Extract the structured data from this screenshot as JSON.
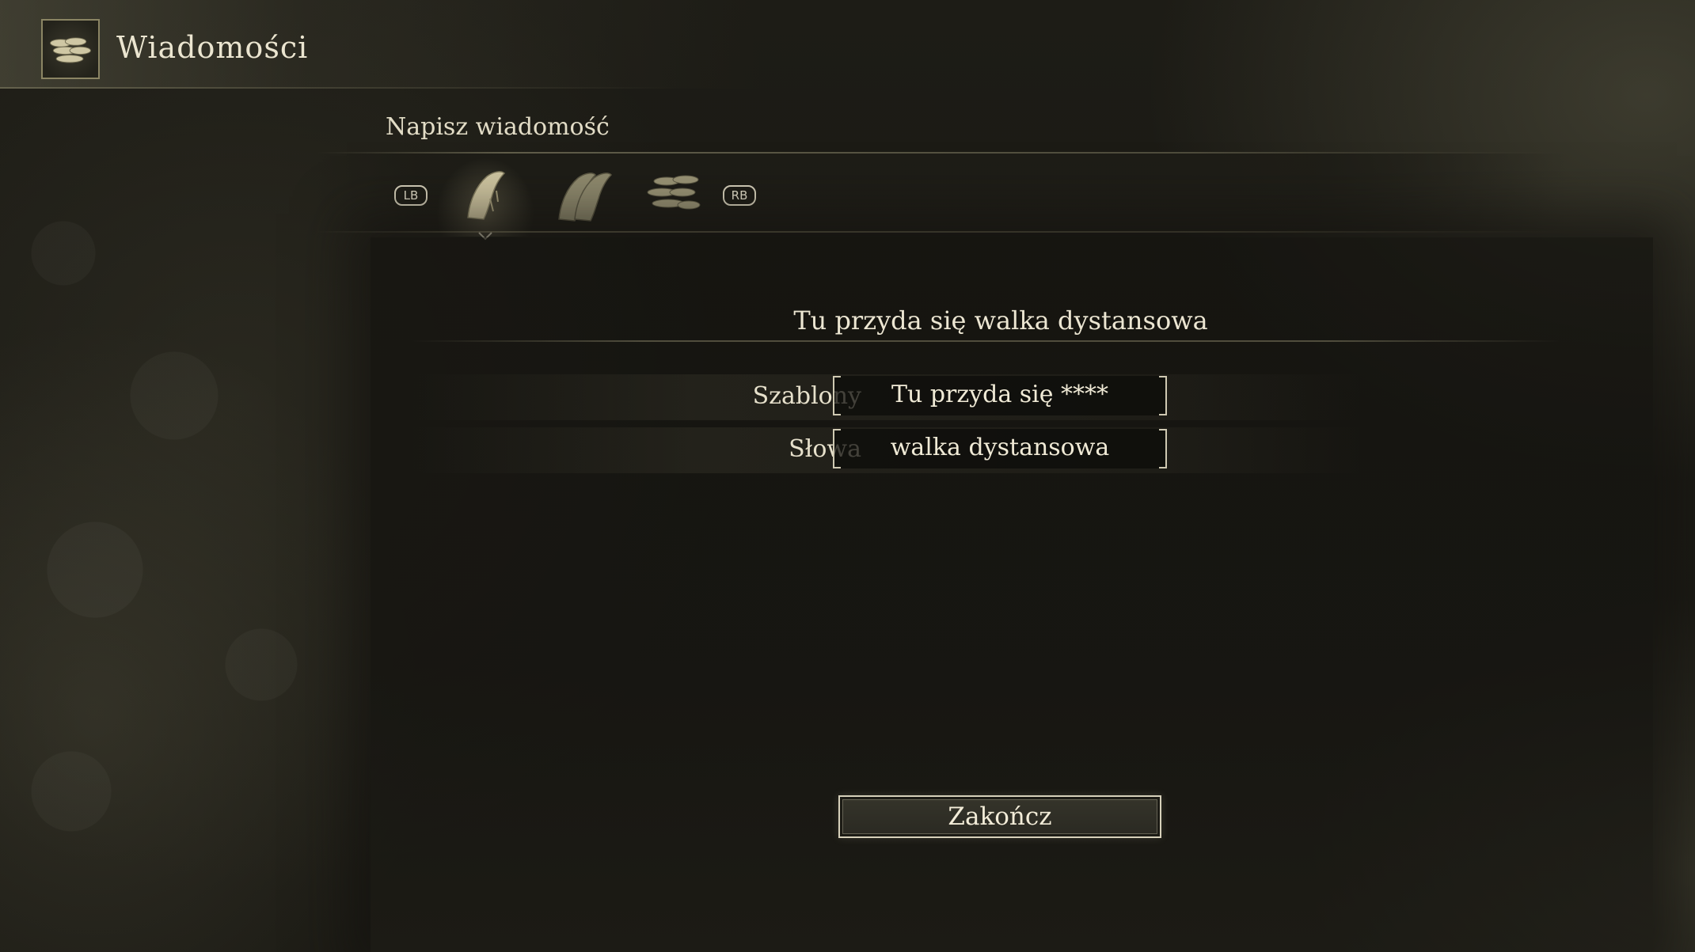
{
  "header": {
    "title": "Wiadomości",
    "icon": "message-scrolls-icon"
  },
  "compose": {
    "section_title": "Napisz wiadomość",
    "prev_tab_hint": "LB",
    "next_tab_hint": "RB",
    "tabs": [
      {
        "icon": "single-message-icon",
        "selected": true
      },
      {
        "icon": "double-message-icon",
        "selected": false
      },
      {
        "icon": "stacked-messages-icon",
        "selected": false
      }
    ]
  },
  "message": {
    "preview": "Tu przyda się walka dystansowa",
    "fields": [
      {
        "label": "Szablony",
        "value": "Tu przyda się ****"
      },
      {
        "label": "Słowa",
        "value": "walka dystansowa"
      }
    ]
  },
  "actions": {
    "finish_label": "Zakończ"
  },
  "colors": {
    "background": "#1a1914",
    "text": "#e9e3cf",
    "accent_border": "#d7d1bb"
  }
}
